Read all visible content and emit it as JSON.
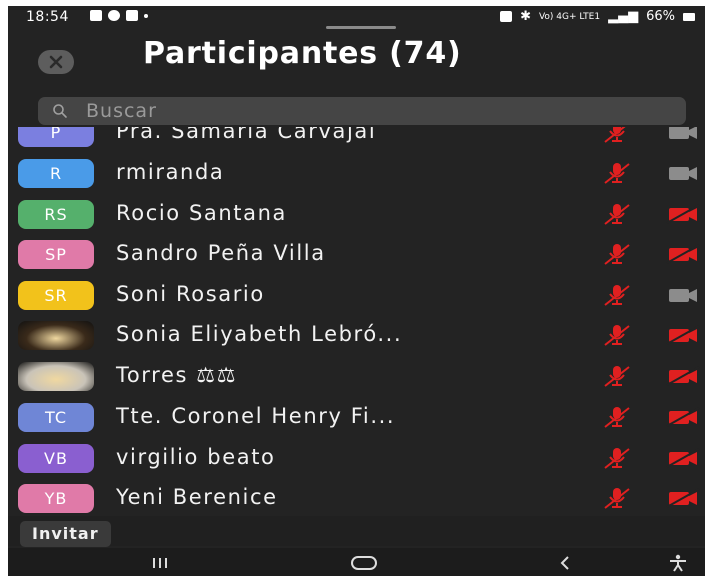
{
  "status_bar": {
    "time": "18:54",
    "network_text": "Vo) 4G+ LTE1",
    "battery_text": "66%"
  },
  "header": {
    "title": "Participantes (74)"
  },
  "search": {
    "placeholder": "Buscar"
  },
  "participants": [
    {
      "initials": "P",
      "name": "Pra. Samaria Carvajal",
      "avatar_color": "#7b7fe0",
      "mic_muted": true,
      "camera_off": false
    },
    {
      "initials": "R",
      "name": "rmiranda",
      "avatar_color": "#4a9be8",
      "mic_muted": true,
      "camera_off": false
    },
    {
      "initials": "RS",
      "name": "Rocio Santana",
      "avatar_color": "#55b06c",
      "mic_muted": true,
      "camera_off": true
    },
    {
      "initials": "SP",
      "name": "Sandro Peña Villa",
      "avatar_color": "#e07aa8",
      "mic_muted": true,
      "camera_off": true
    },
    {
      "initials": "SR",
      "name": "Soni Rosario",
      "avatar_color": "#f2c21b",
      "mic_muted": true,
      "camera_off": false
    },
    {
      "initials": "",
      "name": "Sonia Eliyabeth Lebró...",
      "avatar_color": "#3a2a1a",
      "mic_muted": true,
      "camera_off": true
    },
    {
      "initials": "",
      "name": "Torres ⚖⚖",
      "avatar_color": "#c9c3b8",
      "mic_muted": true,
      "camera_off": true
    },
    {
      "initials": "TC",
      "name": "Tte. Coronel Henry Fi...",
      "avatar_color": "#6f86d6",
      "mic_muted": true,
      "camera_off": true
    },
    {
      "initials": "VB",
      "name": "virgilio beato",
      "avatar_color": "#8a5fd0",
      "mic_muted": true,
      "camera_off": true
    },
    {
      "initials": "YB",
      "name": "Yeni Berenice",
      "avatar_color": "#e07aa8",
      "mic_muted": true,
      "camera_off": true
    }
  ],
  "footer": {
    "invite_label": "Invitar"
  },
  "colors": {
    "background": "#232323",
    "muted_red": "#e02020",
    "camera_on_gray": "#8c8c8c"
  },
  "icons": [
    "close-icon",
    "search-icon",
    "mic-muted-icon",
    "camera-off-icon",
    "camera-icon",
    "recent-apps-icon",
    "home-icon",
    "back-icon",
    "accessibility-icon"
  ]
}
